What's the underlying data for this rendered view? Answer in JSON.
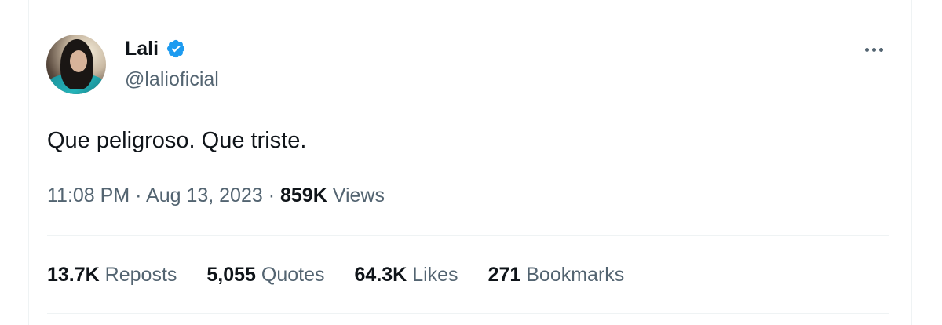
{
  "author": {
    "display_name": "Lali",
    "handle": "@lalioficial",
    "verified": true,
    "verified_color": "#1d9bf0"
  },
  "tweet": {
    "text": "Que peligroso. Que triste.",
    "time": "11:08 PM",
    "date": "Aug 13, 2023",
    "separator": "·",
    "views_count": "859K",
    "views_label": "Views"
  },
  "stats": [
    {
      "count": "13.7K",
      "label": "Reposts"
    },
    {
      "count": "5,055",
      "label": "Quotes"
    },
    {
      "count": "64.3K",
      "label": "Likes"
    },
    {
      "count": "271",
      "label": "Bookmarks"
    }
  ],
  "icons": {
    "more": "more-horizontal-icon",
    "verified": "verified-badge-icon"
  }
}
